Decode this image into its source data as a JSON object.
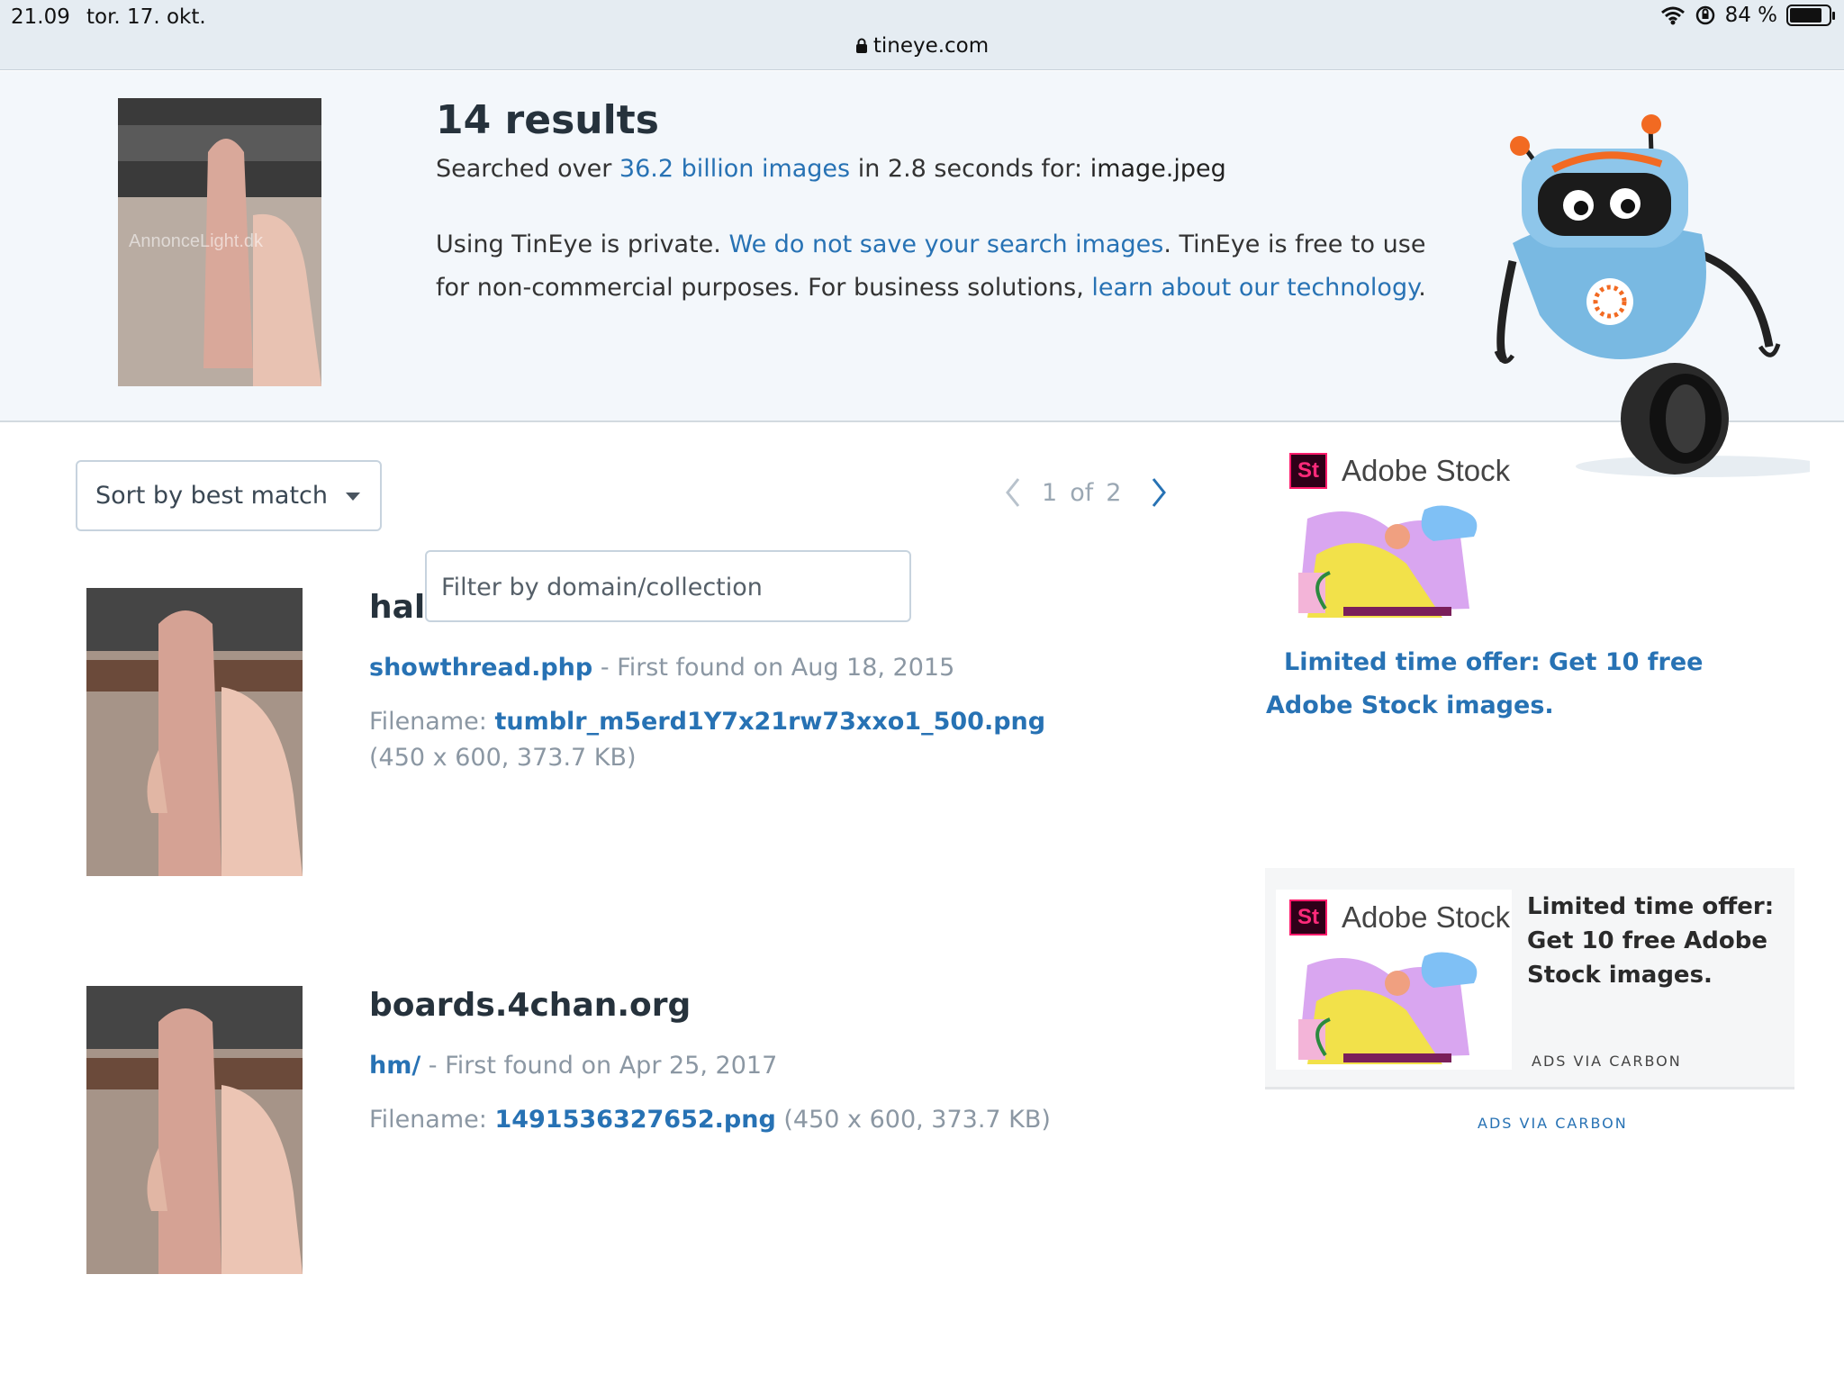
{
  "status_bar": {
    "time": "21.09",
    "date": "tor. 17. okt.",
    "battery": "84 %",
    "battery_level": 0.84,
    "url": "tineye.com"
  },
  "header": {
    "results_title": "14 results",
    "searched_prefix": "Searched over ",
    "searched_link": "36.2 billion images",
    "searched_mid": " in 2.8 seconds for: ",
    "searched_file": "image.jpeg",
    "privacy_prefix": "Using TinEye is private. ",
    "privacy_link": "We do not save your search images",
    "privacy_mid": ". TinEye is free to use for non-commercial purposes. For business solutions, ",
    "privacy_link2": "learn about our technology",
    "privacy_suffix": ".",
    "thumb_watermark": "AnnonceLight.dk"
  },
  "controls": {
    "sort_label": "Sort by best match",
    "page_current": "1",
    "page_of": "of",
    "page_total": "2",
    "filter_placeholder": "Filter by domain/collection"
  },
  "results": [
    {
      "domain": "halohul.com",
      "page": "showthread.php",
      "first_found": " - First found on Aug 18, 2015",
      "filename_label": "Filename: ",
      "filename": "tumblr_m5erd1Y7x21rw73xxo1_500.png",
      "meta": "(450 x 600, 373.7 KB)"
    },
    {
      "domain": "boards.4chan.org",
      "page": "hm/",
      "first_found": " - First found on Apr 25, 2017",
      "filename_label": "Filename: ",
      "filename": "1491536327652.png",
      "meta": " (450 x 600, 373.7 KB)"
    }
  ],
  "ads": {
    "badge": "St",
    "brand": "Adobe Stock",
    "offer": "Limited time offer: Get 10 free Adobe Stock images.",
    "via": "ADS VIA CARBON"
  },
  "colors": {
    "link": "#2772b4",
    "header_bg": "#f3f7fb",
    "status_bg": "#e5ecf2"
  }
}
